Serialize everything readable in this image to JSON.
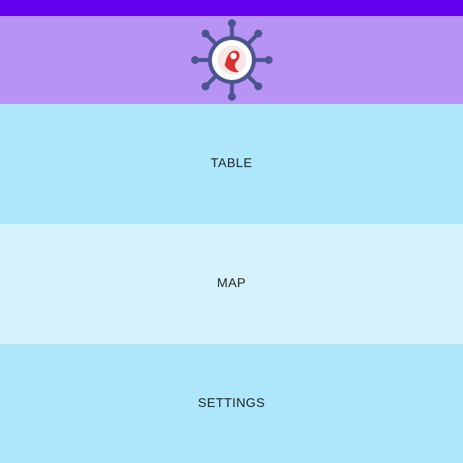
{
  "status_bar": {
    "color": "#6200ee"
  },
  "header": {
    "color": "#b794f4",
    "logo_icon": "ship-wheel-logo"
  },
  "menu": {
    "items": [
      {
        "label": "TABLE",
        "color": "#aee6fb"
      },
      {
        "label": "MAP",
        "color": "#d6f3fd"
      },
      {
        "label": "SETTINGS",
        "color": "#aee6fb"
      }
    ]
  }
}
